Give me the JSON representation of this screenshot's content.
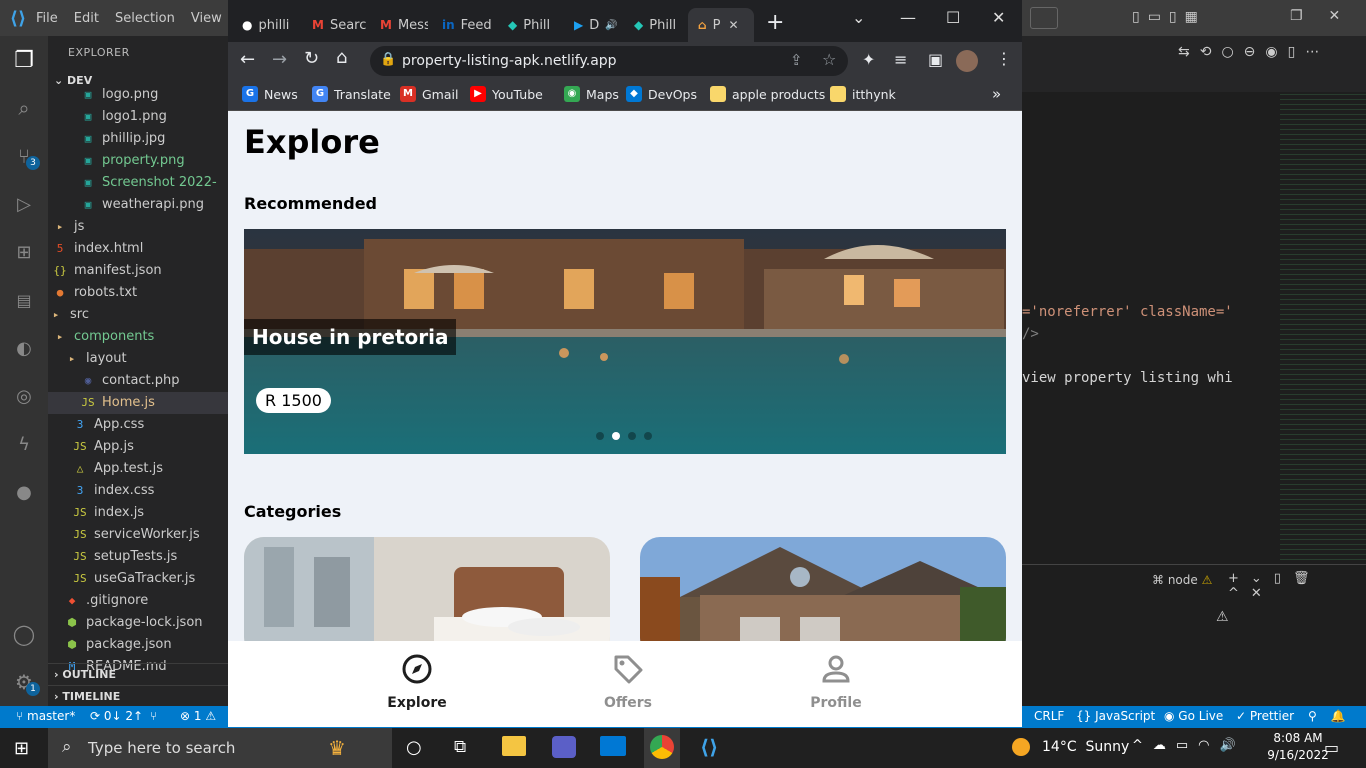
{
  "vscode": {
    "menu": [
      "File",
      "Edit",
      "Selection",
      "View"
    ],
    "sidebar_header": "EXPLORER",
    "root_folder": "DEV",
    "tree": [
      {
        "name": "logo.png",
        "icon": "image-file-icon",
        "color": "#ccc"
      },
      {
        "name": "logo1.png",
        "icon": "image-file-icon",
        "color": "#ccc"
      },
      {
        "name": "phillip.jpg",
        "icon": "image-file-icon",
        "color": "#ccc"
      },
      {
        "name": "property.png",
        "icon": "image-file-icon",
        "color": "#73c991"
      },
      {
        "name": "Screenshot 2022-",
        "icon": "image-file-icon",
        "color": "#73c991"
      },
      {
        "name": "weatherapi.png",
        "icon": "image-file-icon",
        "color": "#ccc"
      },
      {
        "name": "js",
        "icon": "folder-icon",
        "color": "#ccc"
      },
      {
        "name": "index.html",
        "icon": "html-file-icon",
        "color": "#ccc"
      },
      {
        "name": "manifest.json",
        "icon": "json-file-icon",
        "color": "#ccc"
      },
      {
        "name": "robots.txt",
        "icon": "text-file-icon",
        "color": "#ccc"
      },
      {
        "name": "src",
        "icon": "folder-icon",
        "color": "#ccc"
      },
      {
        "name": "components",
        "icon": "folder-icon",
        "color": "#73c991"
      },
      {
        "name": "layout",
        "icon": "folder-icon",
        "color": "#ccc"
      },
      {
        "name": "contact.php",
        "icon": "php-file-icon",
        "color": "#ccc"
      },
      {
        "name": "Home.js",
        "icon": "js-file-icon",
        "color": "#e2c08d"
      },
      {
        "name": "App.css",
        "icon": "css-file-icon",
        "color": "#ccc"
      },
      {
        "name": "App.js",
        "icon": "js-file-icon",
        "color": "#ccc"
      },
      {
        "name": "App.test.js",
        "icon": "test-file-icon",
        "color": "#ccc"
      },
      {
        "name": "index.css",
        "icon": "css-file-icon",
        "color": "#ccc"
      },
      {
        "name": "index.js",
        "icon": "js-file-icon",
        "color": "#ccc"
      },
      {
        "name": "serviceWorker.js",
        "icon": "js-file-icon",
        "color": "#ccc"
      },
      {
        "name": "setupTests.js",
        "icon": "js-file-icon",
        "color": "#ccc"
      },
      {
        "name": "useGaTracker.js",
        "icon": "js-file-icon",
        "color": "#ccc"
      },
      {
        "name": ".gitignore",
        "icon": "git-file-icon",
        "color": "#ccc"
      },
      {
        "name": "package-lock.json",
        "icon": "npm-file-icon",
        "color": "#ccc"
      },
      {
        "name": "package.json",
        "icon": "npm-file-icon",
        "color": "#ccc"
      },
      {
        "name": "README.md",
        "icon": "markdown-file-icon",
        "color": "#ccc"
      }
    ],
    "outline_label": "OUTLINE",
    "timeline_label": "TIMELINE",
    "source_control_badge": "3",
    "settings_badge": "1",
    "code_line_1": "='noreferrer' className='",
    "code_line_2": "/>",
    "code_line_3": "view property listing whi",
    "terminal_label": "node",
    "status": {
      "branch": "master*",
      "sync": "0↓ 2↑",
      "errors": "⊗ 1 ⚠",
      "eol": "CRLF",
      "language": "JavaScript",
      "golive": "Go Live",
      "prettier": "Prettier"
    }
  },
  "chrome": {
    "tabs": [
      {
        "label": "philli",
        "icon": "github-icon"
      },
      {
        "label": "Searc",
        "icon": "gmail-icon"
      },
      {
        "label": "Mess",
        "icon": "gmail-icon"
      },
      {
        "label": "Feed",
        "icon": "linkedin-icon"
      },
      {
        "label": "Phill",
        "icon": "netlify-icon"
      },
      {
        "label": "D",
        "icon": "play-icon"
      },
      {
        "label": "Phill",
        "icon": "netlify-icon"
      },
      {
        "label": "P",
        "icon": "home-icon"
      }
    ],
    "url": "property-listing-apk.netlify.app",
    "bookmarks": [
      {
        "label": "News",
        "color": "#1a73e8",
        "glyph": "G"
      },
      {
        "label": "Translate",
        "color": "#4285f4",
        "glyph": "G"
      },
      {
        "label": "Gmail",
        "color": "#d93025",
        "glyph": "M"
      },
      {
        "label": "YouTube",
        "color": "#ff0000",
        "glyph": "▶"
      },
      {
        "label": "Maps",
        "color": "#34a853",
        "glyph": "◉"
      },
      {
        "label": "DevOps",
        "color": "#0078d4",
        "glyph": "◆"
      },
      {
        "label": "apple products",
        "color": "#f9d76b",
        "glyph": ""
      },
      {
        "label": "itthynk",
        "color": "#f9d76b",
        "glyph": ""
      }
    ]
  },
  "app": {
    "title": "Explore",
    "recommended_heading": "Recommended",
    "listing_name": "House in pretoria",
    "listing_price": "R 1500",
    "categories_heading": "Categories",
    "nav": [
      {
        "label": "Explore",
        "icon": "compass-icon",
        "active": true
      },
      {
        "label": "Offers",
        "icon": "tag-icon",
        "active": false
      },
      {
        "label": "Profile",
        "icon": "person-icon",
        "active": false
      }
    ]
  },
  "taskbar": {
    "search_placeholder": "Type here to search",
    "weather": "14°C  Sunny",
    "time": "8:08 AM",
    "date": "9/16/2022"
  }
}
